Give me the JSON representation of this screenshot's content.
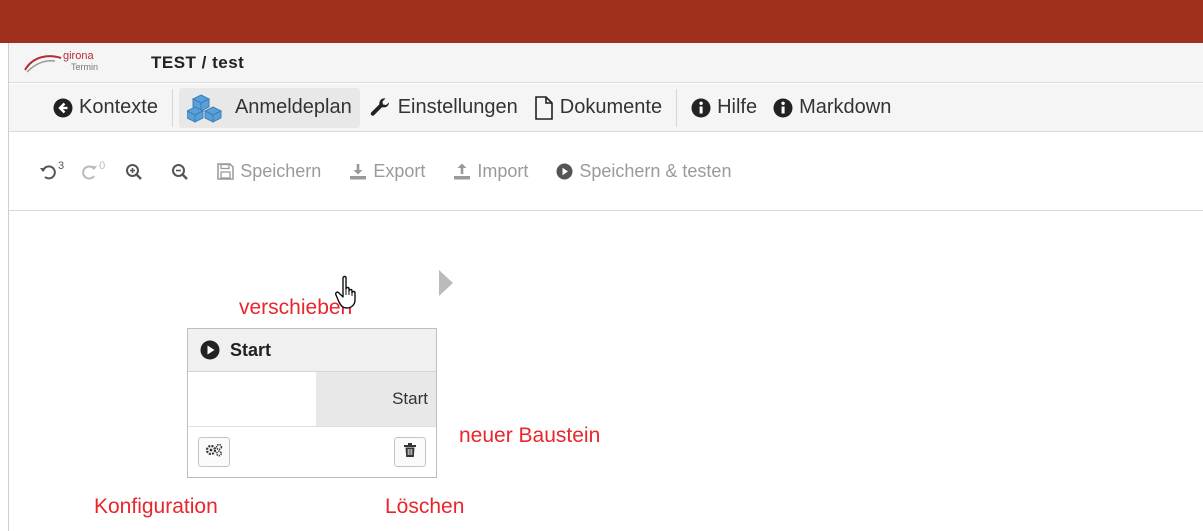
{
  "app": {
    "logo_text_top": "girona",
    "logo_text_bottom": "Termin",
    "title": "TEST / test"
  },
  "nav": {
    "items": [
      {
        "label": "Kontexte",
        "icon": "arrow-circle-left-icon"
      },
      {
        "label": "Anmeldeplan",
        "icon": "cubes-icon",
        "active": true
      },
      {
        "label": "Einstellungen",
        "icon": "wrench-icon"
      },
      {
        "label": "Dokumente",
        "icon": "document-icon"
      },
      {
        "label": "Hilfe",
        "icon": "info-circle-icon"
      },
      {
        "label": "Markdown",
        "icon": "info-circle-icon"
      }
    ]
  },
  "toolbar": {
    "undo_count": "3",
    "redo_count": "0",
    "save_label": "Speichern",
    "export_label": "Export",
    "import_label": "Import",
    "save_test_label": "Speichern & testen"
  },
  "node": {
    "title": "Start",
    "port_label": "Start"
  },
  "annotations": {
    "move": "verschieben",
    "new_block": "neuer Baustein",
    "config": "Konfiguration",
    "delete": "Löschen"
  },
  "colors": {
    "topbar": "#a0301b",
    "annotation": "#e8262b",
    "cubes_icon": "#5aa0d8"
  }
}
